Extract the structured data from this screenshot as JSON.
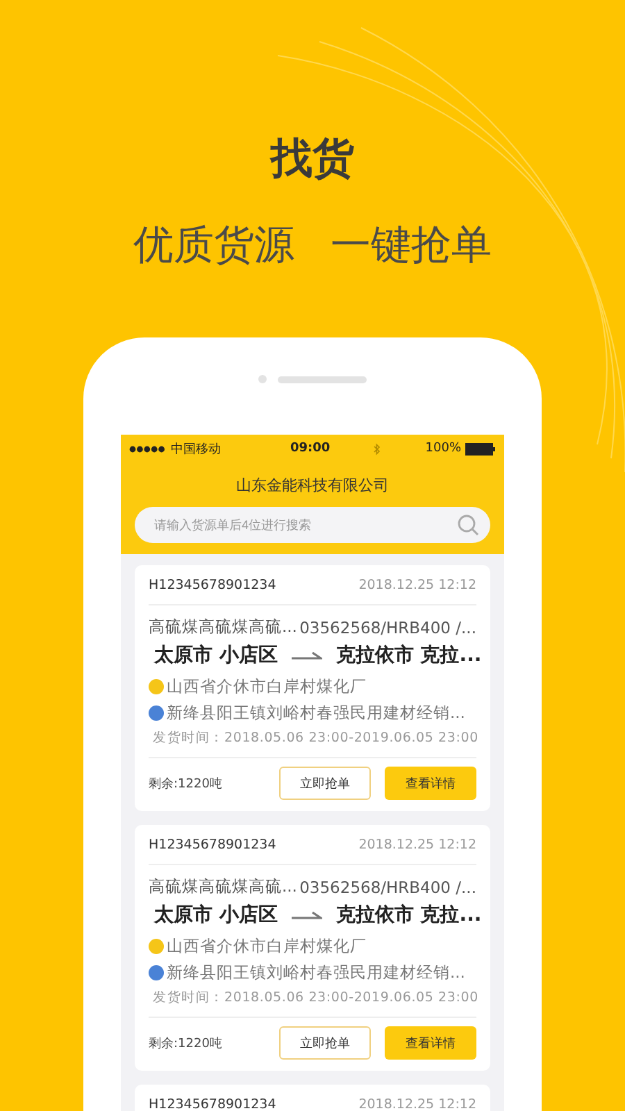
{
  "hero": {
    "title": "找货",
    "subtitle": [
      "优质货源",
      "一键抢单"
    ]
  },
  "status_bar": {
    "carrier": "中国移动",
    "time": "09:00",
    "battery": "100%"
  },
  "app": {
    "title": "山东金能科技有限公司",
    "search": {
      "placeholder": "请输入货源单后4位进行搜索"
    }
  },
  "orders": [
    {
      "order_no": "H12345678901234",
      "time": "2018.12.25 12:12",
      "cargo": "高硫煤高硫煤高硫...",
      "spec": "03562568/HRB400 /...",
      "origin": "太原市 小店区",
      "destination": "克拉依市 克拉...",
      "shipper": "山西省介休市白岸村煤化厂",
      "receiver": "新绛县阳王镇刘峪村春强民用建材经销...",
      "ship_time": "发货时间：2018.05.06 23:00-2019.06.05 23:00",
      "remaining": "剩余:1220吨",
      "grab_button": "立即抢单",
      "detail_button": "查看详情"
    },
    {
      "order_no": "H12345678901234",
      "time": "2018.12.25 12:12",
      "cargo": "高硫煤高硫煤高硫...",
      "spec": "03562568/HRB400 /...",
      "origin": "太原市 小店区",
      "destination": "克拉依市 克拉...",
      "shipper": "山西省介休市白岸村煤化厂",
      "receiver": "新绛县阳王镇刘峪村春强民用建材经销...",
      "ship_time": "发货时间：2018.05.06 23:00-2019.06.05 23:00",
      "remaining": "剩余:1220吨",
      "grab_button": "立即抢单",
      "detail_button": "查看详情"
    },
    {
      "order_no": "H12345678901234",
      "time": "2018.12.25 12:12"
    }
  ]
}
